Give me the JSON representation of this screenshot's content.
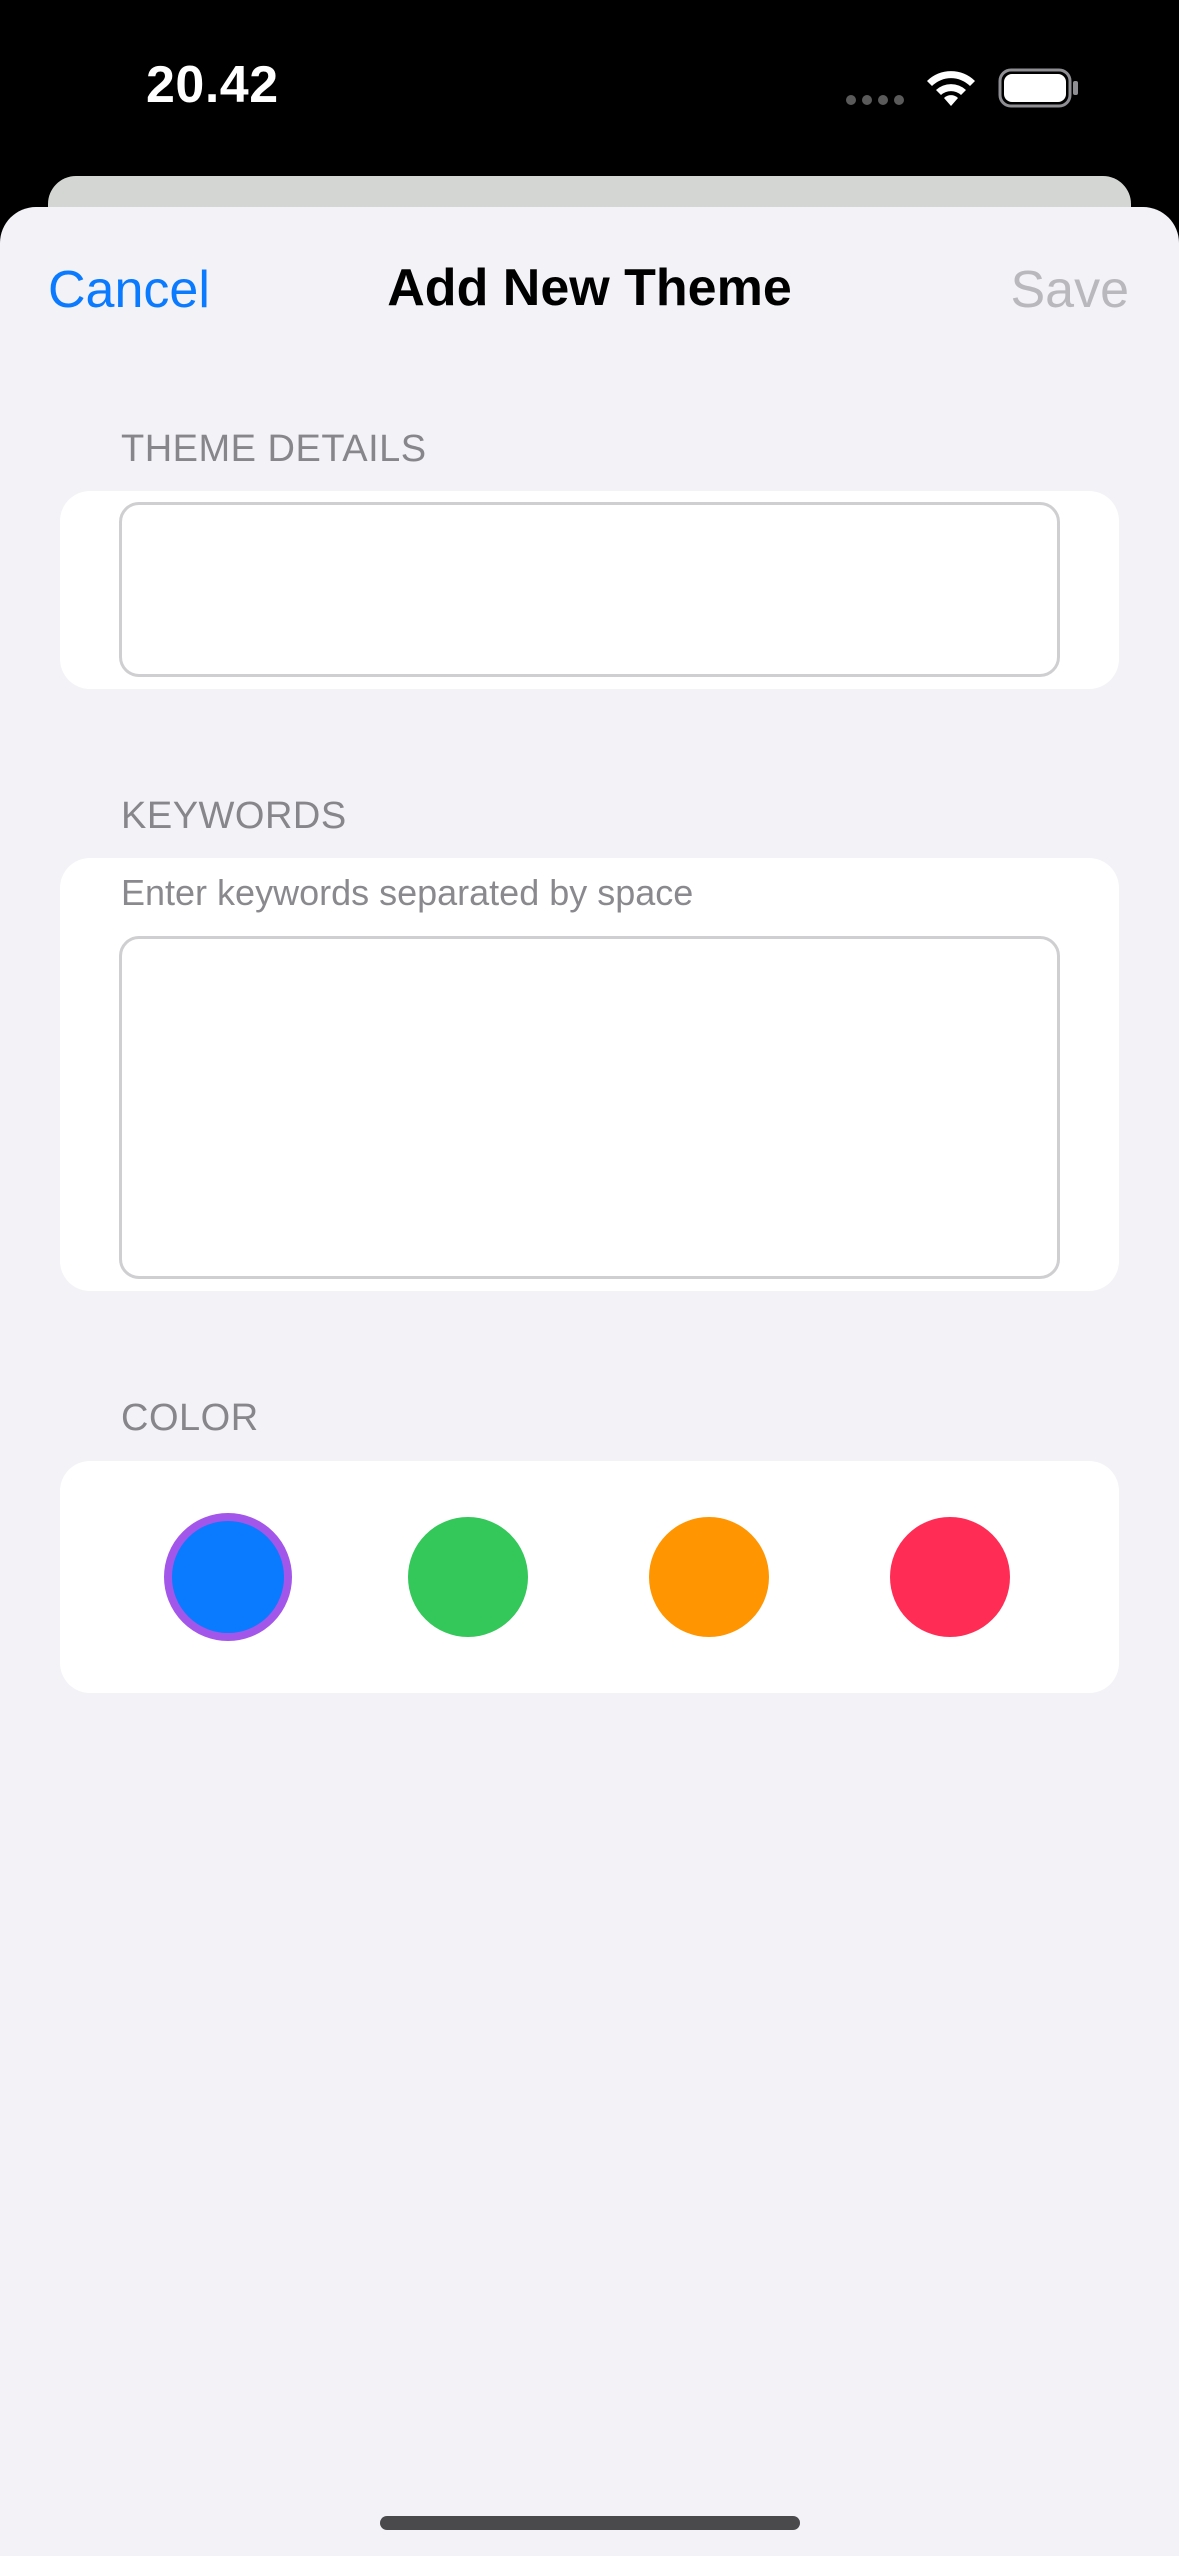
{
  "status_bar": {
    "time": "20.42",
    "wifi_icon": "wifi-icon",
    "battery_icon": "battery-icon"
  },
  "nav": {
    "cancel_label": "Cancel",
    "title": "Add New Theme",
    "save_label": "Save"
  },
  "theme_details": {
    "header": "THEME DETAILS",
    "value": ""
  },
  "keywords": {
    "header": "KEYWORDS",
    "hint": "Enter keywords separated by space",
    "value": ""
  },
  "color": {
    "header": "COLOR",
    "selected": "blue",
    "options": [
      {
        "name": "blue",
        "hex": "#0a7aff"
      },
      {
        "name": "green",
        "hex": "#34c759"
      },
      {
        "name": "orange",
        "hex": "#ff9500"
      },
      {
        "name": "pink",
        "hex": "#ff2d55"
      }
    ],
    "selection_ring_hex": "#a356ea"
  },
  "colors": {
    "accent": "#0a7aff",
    "disabled": "#b8b8bd",
    "background": "#f2f2f7"
  }
}
